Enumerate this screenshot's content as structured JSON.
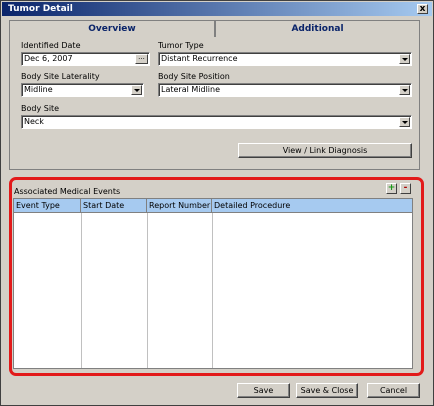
{
  "window": {
    "title": "Tumor Detail",
    "close_glyph": "x"
  },
  "tabs": [
    {
      "label": "Overview",
      "active": true
    },
    {
      "label": "Additional",
      "active": false
    }
  ],
  "form": {
    "identified_date": {
      "label": "Identified Date",
      "value": "Dec 6, 2007",
      "button_glyph": "..."
    },
    "tumor_type": {
      "label": "Tumor Type",
      "value": "Distant Recurrence"
    },
    "body_site_laterality": {
      "label": "Body Site Laterality",
      "value": "Midline"
    },
    "body_site_position": {
      "label": "Body Site Position",
      "value": "Lateral Midline"
    },
    "body_site": {
      "label": "Body Site",
      "value": "Neck"
    }
  },
  "view_link_button": "View / Link Diagnosis",
  "events": {
    "title": "Associated Medical Events",
    "add_glyph": "+",
    "remove_glyph": "-",
    "columns": [
      "Event Type",
      "Start Date",
      "Report Number",
      "Detailed Procedure"
    ],
    "rows": []
  },
  "footer": {
    "save": "Save",
    "save_close": "Save & Close",
    "cancel": "Cancel"
  },
  "colors": {
    "highlight_border": "#e21a1a",
    "header_bg": "#a6caf0",
    "title_bar": "#0a246a"
  }
}
